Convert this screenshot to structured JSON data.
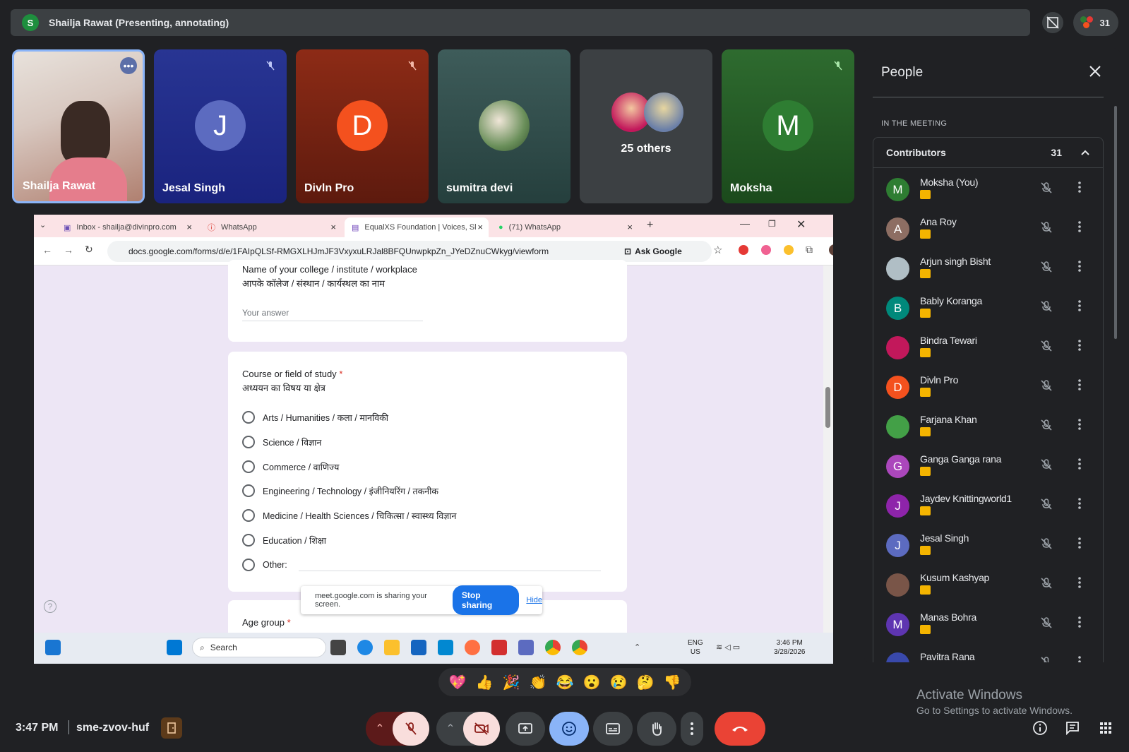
{
  "presenter": {
    "initial": "S",
    "label": "Shailja Rawat (Presenting, annotating)"
  },
  "participants_count": "31",
  "tiles": [
    {
      "name": "Shailja Rawat"
    },
    {
      "name": "Jesal Singh",
      "initial": "J"
    },
    {
      "name": "Divln Pro",
      "initial": "D"
    },
    {
      "name": "sumitra devi"
    },
    {
      "name": "25 others"
    },
    {
      "name": "Moksha",
      "initial": "M"
    }
  ],
  "people": {
    "title": "People",
    "section": "IN THE MEETING",
    "group": "Contributors",
    "count": "31",
    "list": [
      {
        "initial": "M",
        "name": "Moksha (You)",
        "color": "#2e7d32"
      },
      {
        "initial": "A",
        "name": "Ana Roy",
        "color": "#8d6e63"
      },
      {
        "initial": "",
        "name": "Arjun singh Bisht",
        "color": "#b0bec5"
      },
      {
        "initial": "B",
        "name": "Bably Koranga",
        "color": "#00897b"
      },
      {
        "initial": "",
        "name": "Bindra Tewari",
        "color": "#c2185b"
      },
      {
        "initial": "D",
        "name": "Divln Pro",
        "color": "#f4511e"
      },
      {
        "initial": "",
        "name": "Farjana Khan",
        "color": "#43a047"
      },
      {
        "initial": "G",
        "name": "Ganga Ganga rana",
        "color": "#ab47bc"
      },
      {
        "initial": "J",
        "name": "Jaydev Knittingworld1",
        "color": "#8e24aa"
      },
      {
        "initial": "J",
        "name": "Jesal Singh",
        "color": "#5c6bc0"
      },
      {
        "initial": "",
        "name": "Kusum Kashyap",
        "color": "#795548"
      },
      {
        "initial": "M",
        "name": "Manas Bohra",
        "color": "#5e35b1"
      },
      {
        "initial": "",
        "name": "Pavitra Rana",
        "color": "#3949ab"
      }
    ]
  },
  "browser": {
    "tabs": [
      "Inbox - shailja@divinpro.com",
      "WhatsApp",
      "EqualXS Foundation | Voices, Sl",
      "(71) WhatsApp"
    ],
    "url": "docs.google.com/forms/d/e/1FAIpQLSf-RMGXLHJmJF3VxyxuLRJal8BFQUnwpkpZn_JYeDZnuCWkyg/viewform",
    "ask_google": "Ask Google"
  },
  "form": {
    "q1_en": "Name of your college / institute / workplace",
    "q1_hi": "आपके कॉलेज / संस्थान / कार्यस्थल का नाम",
    "answer_placeholder": "Your answer",
    "q2_en": "Course or field of study",
    "q2_hi": "अध्ययन का विषय या क्षेत्र",
    "required": "*",
    "options": [
      "Arts / Humanities / कला / मानविकी",
      "Science / विज्ञान",
      "Commerce / वाणिज्य",
      "Engineering / Technology / इंजीनियरिंग / तकनीक",
      "Medicine / Health Sciences / चिकित्सा / स्वास्थ्य विज्ञान",
      "Education / शिक्षा",
      "Other:"
    ],
    "q3_en": "Age group"
  },
  "sharing_bar": {
    "text": "meet.google.com is sharing your screen.",
    "stop": "Stop sharing",
    "hide": "Hide"
  },
  "taskbar": {
    "search": "Search",
    "lang1": "ENG",
    "lang2": "US",
    "time": "3:46 PM",
    "date": "3/28/2026"
  },
  "reactions": [
    "💖",
    "👍",
    "🎉",
    "👏",
    "😂",
    "😮",
    "😢",
    "🤔",
    "👎"
  ],
  "footer": {
    "time": "3:47 PM",
    "meeting_code": "sme-zvov-huf"
  },
  "activate": {
    "line1": "Activate Windows",
    "line2": "Go to Settings to activate Windows."
  }
}
